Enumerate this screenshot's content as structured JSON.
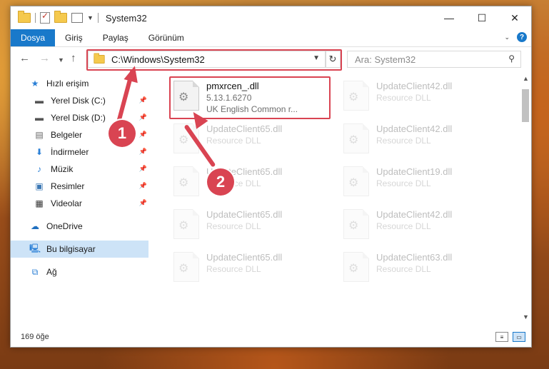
{
  "window": {
    "title": "System32",
    "controls": {
      "minimize": "—",
      "maximize": "☐",
      "close": "✕"
    }
  },
  "ribbon": {
    "file_tab": "Dosya",
    "tabs": [
      "Giriş",
      "Paylaş",
      "Görünüm"
    ]
  },
  "navigation": {
    "address": "C:\\Windows\\System32",
    "search_placeholder": "Ara: System32"
  },
  "sidebar": {
    "items": [
      {
        "label": "Hızlı erişim",
        "icon": "star-icon",
        "pinned": false
      },
      {
        "label": "Yerel Disk (C:)",
        "icon": "drive-icon",
        "pinned": true
      },
      {
        "label": "Yerel Disk (D:)",
        "icon": "drive-icon",
        "pinned": true
      },
      {
        "label": "Belgeler",
        "icon": "documents-icon",
        "pinned": true
      },
      {
        "label": "İndirmeler",
        "icon": "download-icon",
        "pinned": true
      },
      {
        "label": "Müzik",
        "icon": "music-icon",
        "pinned": true
      },
      {
        "label": "Resimler",
        "icon": "pictures-icon",
        "pinned": true
      },
      {
        "label": "Videolar",
        "icon": "videos-icon",
        "pinned": true
      },
      {
        "label": "OneDrive",
        "icon": "cloud-icon",
        "pinned": false
      },
      {
        "label": "Bu bilgisayar",
        "icon": "computer-icon",
        "pinned": false,
        "selected": true
      },
      {
        "label": "Ağ",
        "icon": "network-icon",
        "pinned": false
      }
    ]
  },
  "files": [
    {
      "name": "pmxrcen_.dll",
      "line1": "5.13.1.6270",
      "line2": "UK English Common r...",
      "highlighted": true
    },
    {
      "name": "UpdateClient42.dll",
      "line1": "Resource DLL"
    },
    {
      "name": "UpdateClient65.dll",
      "line1": "Resource DLL"
    },
    {
      "name": "UpdateClient42.dll",
      "line1": "Resource DLL"
    },
    {
      "name": "UpdateClient65.dll",
      "line1": "Resource DLL"
    },
    {
      "name": "UpdateClient19.dll",
      "line1": "Resource DLL"
    },
    {
      "name": "UpdateClient65.dll",
      "line1": "Resource DLL"
    },
    {
      "name": "UpdateClient42.dll",
      "line1": "Resource DLL"
    },
    {
      "name": "UpdateClient65.dll",
      "line1": "Resource DLL"
    },
    {
      "name": "UpdateClient63.dll",
      "line1": "Resource DLL"
    }
  ],
  "status": {
    "count": "169 öğe"
  },
  "callouts": {
    "step1": "1",
    "step2": "2"
  },
  "colors": {
    "accent": "#1979ca",
    "highlight": "#d94452"
  }
}
